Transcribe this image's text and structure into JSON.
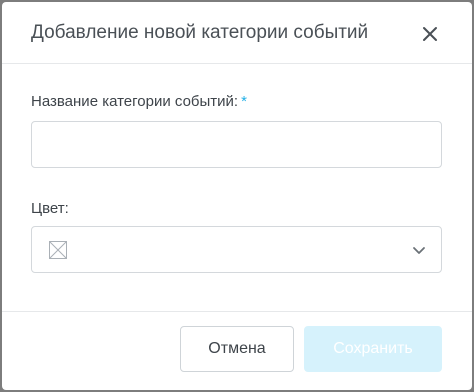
{
  "dialog": {
    "title": "Добавление новой категории событий",
    "close_icon": "close-icon"
  },
  "form": {
    "name_label": "Название категории событий:",
    "required_mark": "*",
    "name_value": "",
    "color_label": "Цвет:",
    "color_swatch_icon": "empty-swatch-icon",
    "color_dropdown_icon": "chevron-down-icon"
  },
  "footer": {
    "cancel_label": "Отмена",
    "save_label": "Сохранить"
  },
  "colors": {
    "accent": "#23b0e6",
    "save_disabled_bg": "#d6f2fc",
    "border": "#d4d8dc"
  }
}
